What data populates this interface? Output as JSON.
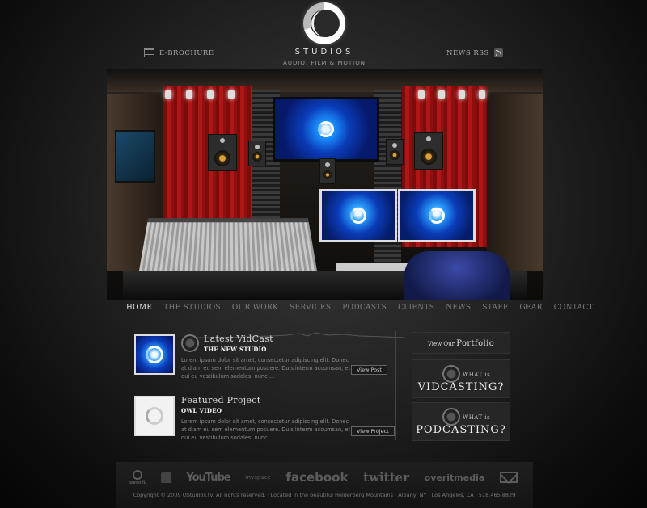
{
  "header": {
    "logo_name": "STUDIOS",
    "logo_tagline": "AUDIO, FILM & MOTION",
    "brochure_label": "E-BROCHURE",
    "news_label": "NEWS RSS"
  },
  "nav": {
    "items": [
      "HOME",
      "THE STUDIOS",
      "OUR WORK",
      "SERVICES",
      "PODCASTS",
      "CLIENTS",
      "NEWS",
      "STAFF",
      "GEAR",
      "CONTACT"
    ],
    "active": "HOME"
  },
  "posts": [
    {
      "title": "Latest VidCast",
      "subtitle": "THE NEW STUDIO",
      "text": "Lorem ipsum dolor sit amet, consectetur adipiscing elit. Donec at diam eu sem elementum posuere. Duis interm accumsan, et dui eu vestibulum sodales, nunc ...",
      "button": "View Post"
    },
    {
      "title": "Featured Project",
      "subtitle": "OWL VIDEO",
      "text": "Lorem ipsum dolor sit amet, consectetur adipiscing elit. Donec at diam eu sem elementum posuere. Duis interm accumsan, et dui eu vestibulum sodales, nunc...",
      "button": "View Project"
    }
  ],
  "sidebar": {
    "portfolio_prefix": "View Our",
    "portfolio_label": "Portfolio",
    "vidcast_small": "WHAT is",
    "vidcast_big": "VIDCASTING?",
    "podcast_small": "WHAT is",
    "podcast_big": "PODCASTING?"
  },
  "footer": {
    "overit_label": "overit",
    "youtube_label": "YouTube",
    "myspace_label": "myspace",
    "facebook_label": "facebook",
    "twitter_label": "twitter",
    "overitmedia_label": "overitmedia",
    "copyright": "Copyright © 2009 OStudios.tv. All rights reserved. · Located in the beautiful Helderberg Mountains · Albany, NY · Los Angeles, CA · 518.465.8829"
  }
}
